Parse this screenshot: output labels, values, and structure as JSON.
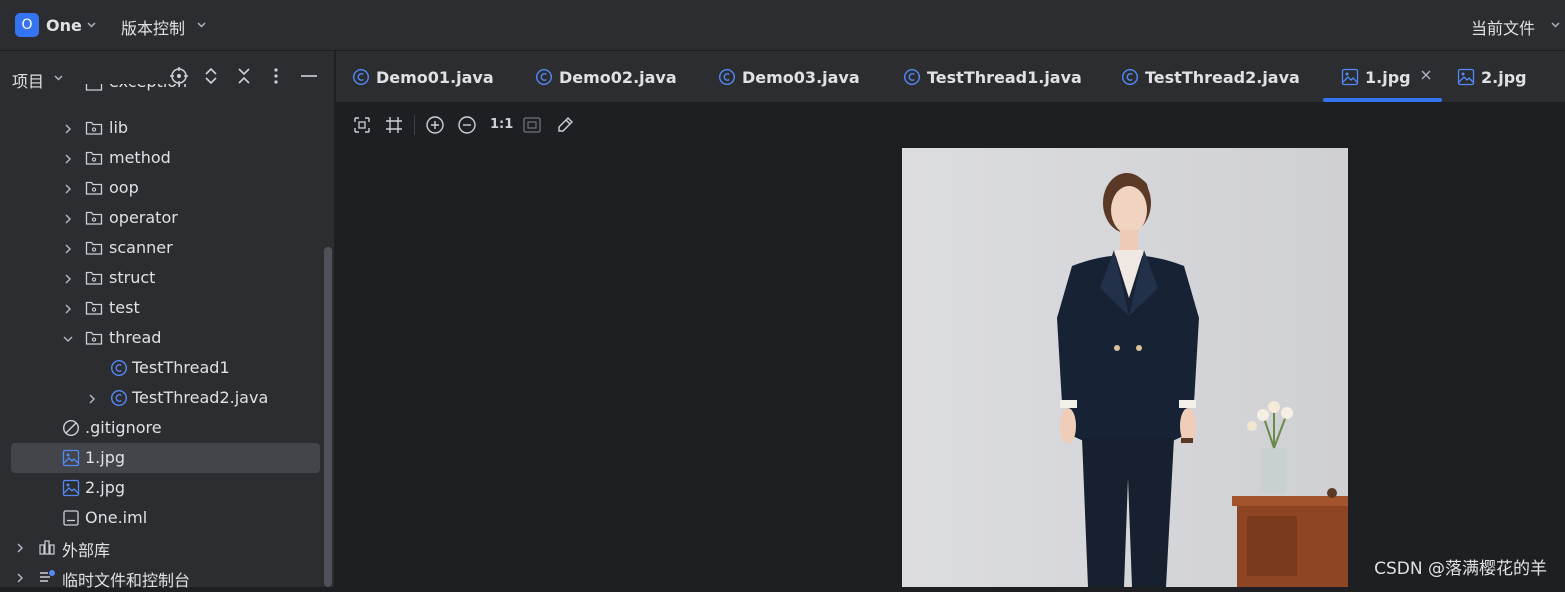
{
  "topbar": {
    "project_badge": "O",
    "project_name": "One",
    "vcs_label": "版本控制",
    "current_file_label": "当前文件"
  },
  "sidebar": {
    "title": "项目",
    "partial_top_item": "exception",
    "items": [
      {
        "label": "lib",
        "kind": "folder"
      },
      {
        "label": "method",
        "kind": "folder"
      },
      {
        "label": "oop",
        "kind": "folder"
      },
      {
        "label": "operator",
        "kind": "folder"
      },
      {
        "label": "scanner",
        "kind": "folder"
      },
      {
        "label": "struct",
        "kind": "folder"
      },
      {
        "label": "test",
        "kind": "folder"
      },
      {
        "label": "thread",
        "kind": "folder-open"
      },
      {
        "label": "TestThread1",
        "kind": "class"
      },
      {
        "label": "TestThread2.java",
        "kind": "class"
      },
      {
        "label": ".gitignore",
        "kind": "ignore"
      },
      {
        "label": "1.jpg",
        "kind": "image",
        "selected": true
      },
      {
        "label": "2.jpg",
        "kind": "image"
      },
      {
        "label": "One.iml",
        "kind": "iml"
      },
      {
        "label": "外部库",
        "kind": "library"
      },
      {
        "label": "临时文件和控制台",
        "kind": "scratch"
      }
    ]
  },
  "tabs": [
    {
      "label": "Demo01.java",
      "icon": "class-icon"
    },
    {
      "label": "Demo02.java",
      "icon": "class-icon"
    },
    {
      "label": "Demo03.java",
      "icon": "class-icon"
    },
    {
      "label": "TestThread1.java",
      "icon": "class-icon"
    },
    {
      "label": "TestThread2.java",
      "icon": "class-icon"
    },
    {
      "label": "1.jpg",
      "icon": "image-icon",
      "active": true
    },
    {
      "label": "2.jpg",
      "icon": "image-icon"
    }
  ],
  "image_toolbar": {
    "actual_size_label": "1:1"
  },
  "watermark": "CSDN @落满樱花的羊",
  "colors": {
    "accent": "#3574f0",
    "panel": "#2b2d30",
    "editor": "#1e1f22",
    "text": "#dfe1e5"
  }
}
